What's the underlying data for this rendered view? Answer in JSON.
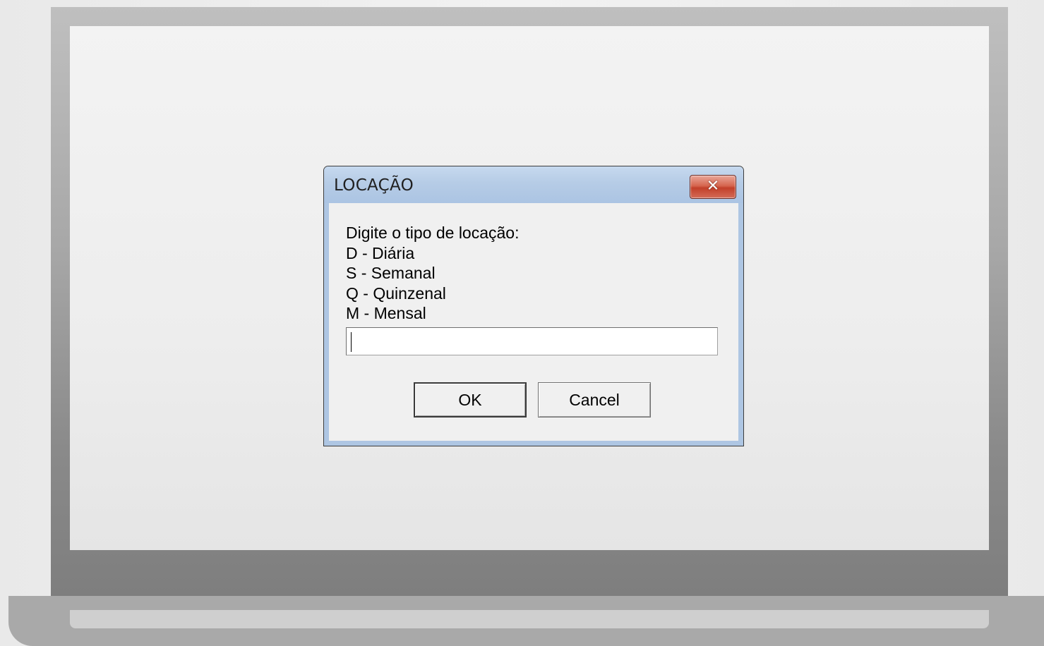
{
  "dialog": {
    "title": "LOCAÇÃO",
    "close_icon": "close-icon",
    "close_glyph": "✕",
    "prompt_lines": [
      "Digite o tipo de locação:",
      "D - Diária",
      "S - Semanal",
      "Q - Quinzenal",
      "M - Mensal"
    ],
    "input": {
      "value": "",
      "placeholder": ""
    },
    "ok_label": "OK",
    "cancel_label": "Cancel"
  },
  "colors": {
    "titlebar": "#b6cce6",
    "close_button": "#c2402a",
    "dialog_background": "#f0f0f0"
  }
}
